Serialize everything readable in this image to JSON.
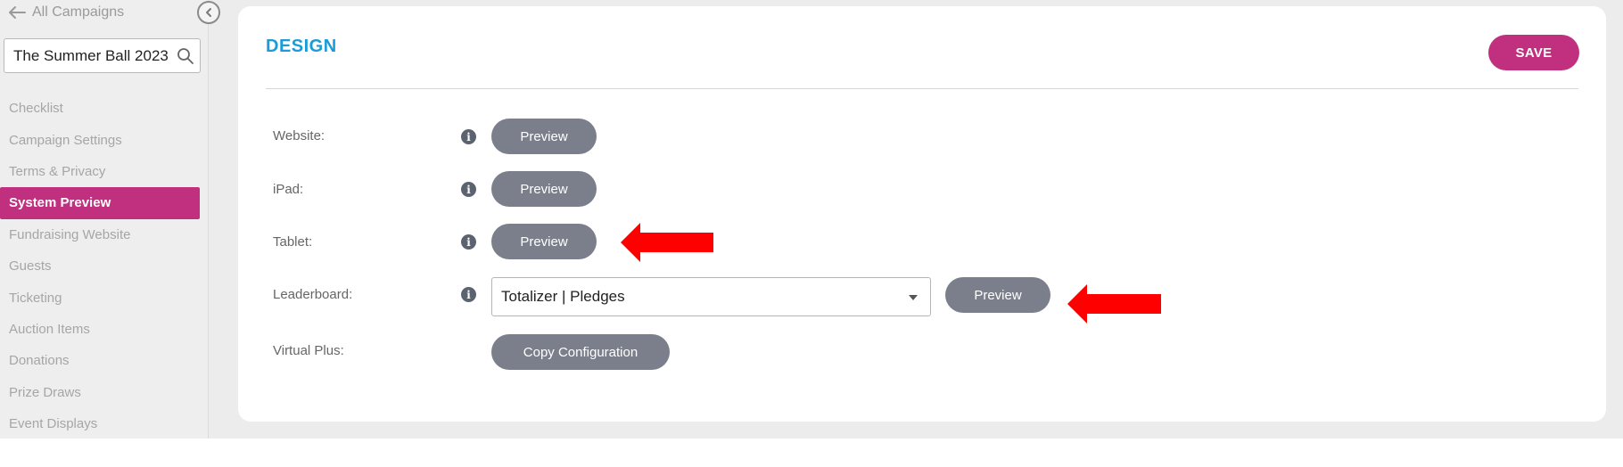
{
  "sidebar": {
    "back_label": "All Campaigns",
    "campaign_search_value": "The Summer Ball 2023",
    "items": [
      {
        "label": "Checklist"
      },
      {
        "label": "Campaign Settings"
      },
      {
        "label": "Terms & Privacy"
      },
      {
        "label": "System Preview"
      },
      {
        "label": "Fundraising Website"
      },
      {
        "label": "Guests"
      },
      {
        "label": "Ticketing"
      },
      {
        "label": "Auction Items"
      },
      {
        "label": "Donations"
      },
      {
        "label": "Prize Draws"
      },
      {
        "label": "Event Displays"
      }
    ],
    "active_item": "System Preview"
  },
  "main": {
    "title": "DESIGN",
    "save_label": "SAVE",
    "rows": [
      {
        "label": "Website:",
        "button": "Preview"
      },
      {
        "label": "iPad:",
        "button": "Preview"
      },
      {
        "label": "Tablet:",
        "button": "Preview"
      },
      {
        "label": "Leaderboard:",
        "select_value": "Totalizer | Pledges",
        "button": "Preview"
      },
      {
        "label": "Virtual Plus:",
        "button": "Copy Configuration"
      }
    ]
  },
  "icons": {
    "back": "arrow-left-icon",
    "collapse": "chevron-left-icon",
    "search": "search-icon",
    "info": "info-icon",
    "dropdown": "caret-down-icon",
    "annotation": "red-arrow-icon"
  },
  "colors": {
    "accent": "#c0307f",
    "title": "#1b9bd7",
    "pill": "#7a7f8b",
    "annotation": "#ff0000"
  }
}
